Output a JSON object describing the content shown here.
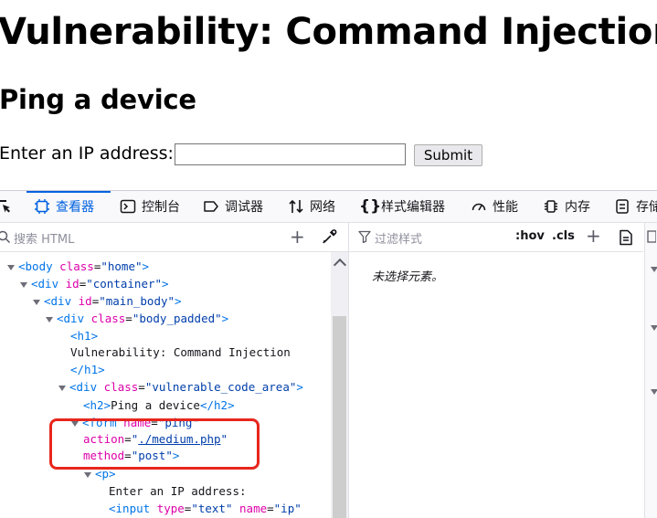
{
  "page": {
    "title": "Vulnerability: Command Injection",
    "subtitle": "Ping a device",
    "ip_label": "Enter an IP address:",
    "ip_value": "",
    "submit_label": "Submit"
  },
  "devtools": {
    "tabs": [
      {
        "label": "查看器",
        "icon": "inspector-icon",
        "active": true
      },
      {
        "label": "控制台",
        "icon": "console-icon",
        "active": false
      },
      {
        "label": "调试器",
        "icon": "debugger-icon",
        "active": false
      },
      {
        "label": "网络",
        "icon": "network-icon",
        "active": false
      },
      {
        "label": "样式编辑器",
        "icon": "style-editor-icon",
        "active": false
      },
      {
        "label": "性能",
        "icon": "performance-icon",
        "active": false
      },
      {
        "label": "内存",
        "icon": "memory-icon",
        "active": false
      },
      {
        "label": "存储",
        "icon": "storage-icon",
        "active": false
      }
    ],
    "search_placeholder": "搜索 HTML",
    "filter_placeholder": "过滤样式",
    "hov_label": ":hov",
    "cls_label": ".cls",
    "no_element_text": "未选择元素。",
    "tree": {
      "body_open": {
        "tag": "<body",
        "attr": "class",
        "val": "\"home\"",
        "end": ">"
      },
      "container_open": {
        "tag": "<div",
        "attr": "id",
        "val": "\"container\"",
        "end": ">"
      },
      "main_body_open": {
        "tag": "<div",
        "attr": "id",
        "val": "\"main_body\"",
        "end": ">"
      },
      "body_padded_open": {
        "tag": "<div",
        "attr": "class",
        "val": "\"body_padded\"",
        "end": ">"
      },
      "h1_open": "<h1>",
      "h1_text": "Vulnerability: Command Injection",
      "h1_close": "</h1>",
      "vca_open": {
        "tag": "<div",
        "attr": "class",
        "val": "\"vulnerable_code_area\"",
        "end": ">"
      },
      "h2_open": "<h2>",
      "h2_text": "Ping a device",
      "h2_close": "</h2>",
      "form": {
        "tag": "<form",
        "attr_name": "name",
        "val_name": "\"ping\"",
        "attr_action": "action",
        "val_action_q1": "\"",
        "val_action_link": "./medium.php",
        "val_action_q2": "\"",
        "attr_method": "method",
        "val_method": "\"post\"",
        "end": ">"
      },
      "p_open": "<p>",
      "p_text": "Enter an IP address:",
      "input": {
        "tag": "<input",
        "attr_type": "type",
        "val_type": "\"text\"",
        "attr_name": "name",
        "val_name": "\"ip\""
      }
    }
  }
}
